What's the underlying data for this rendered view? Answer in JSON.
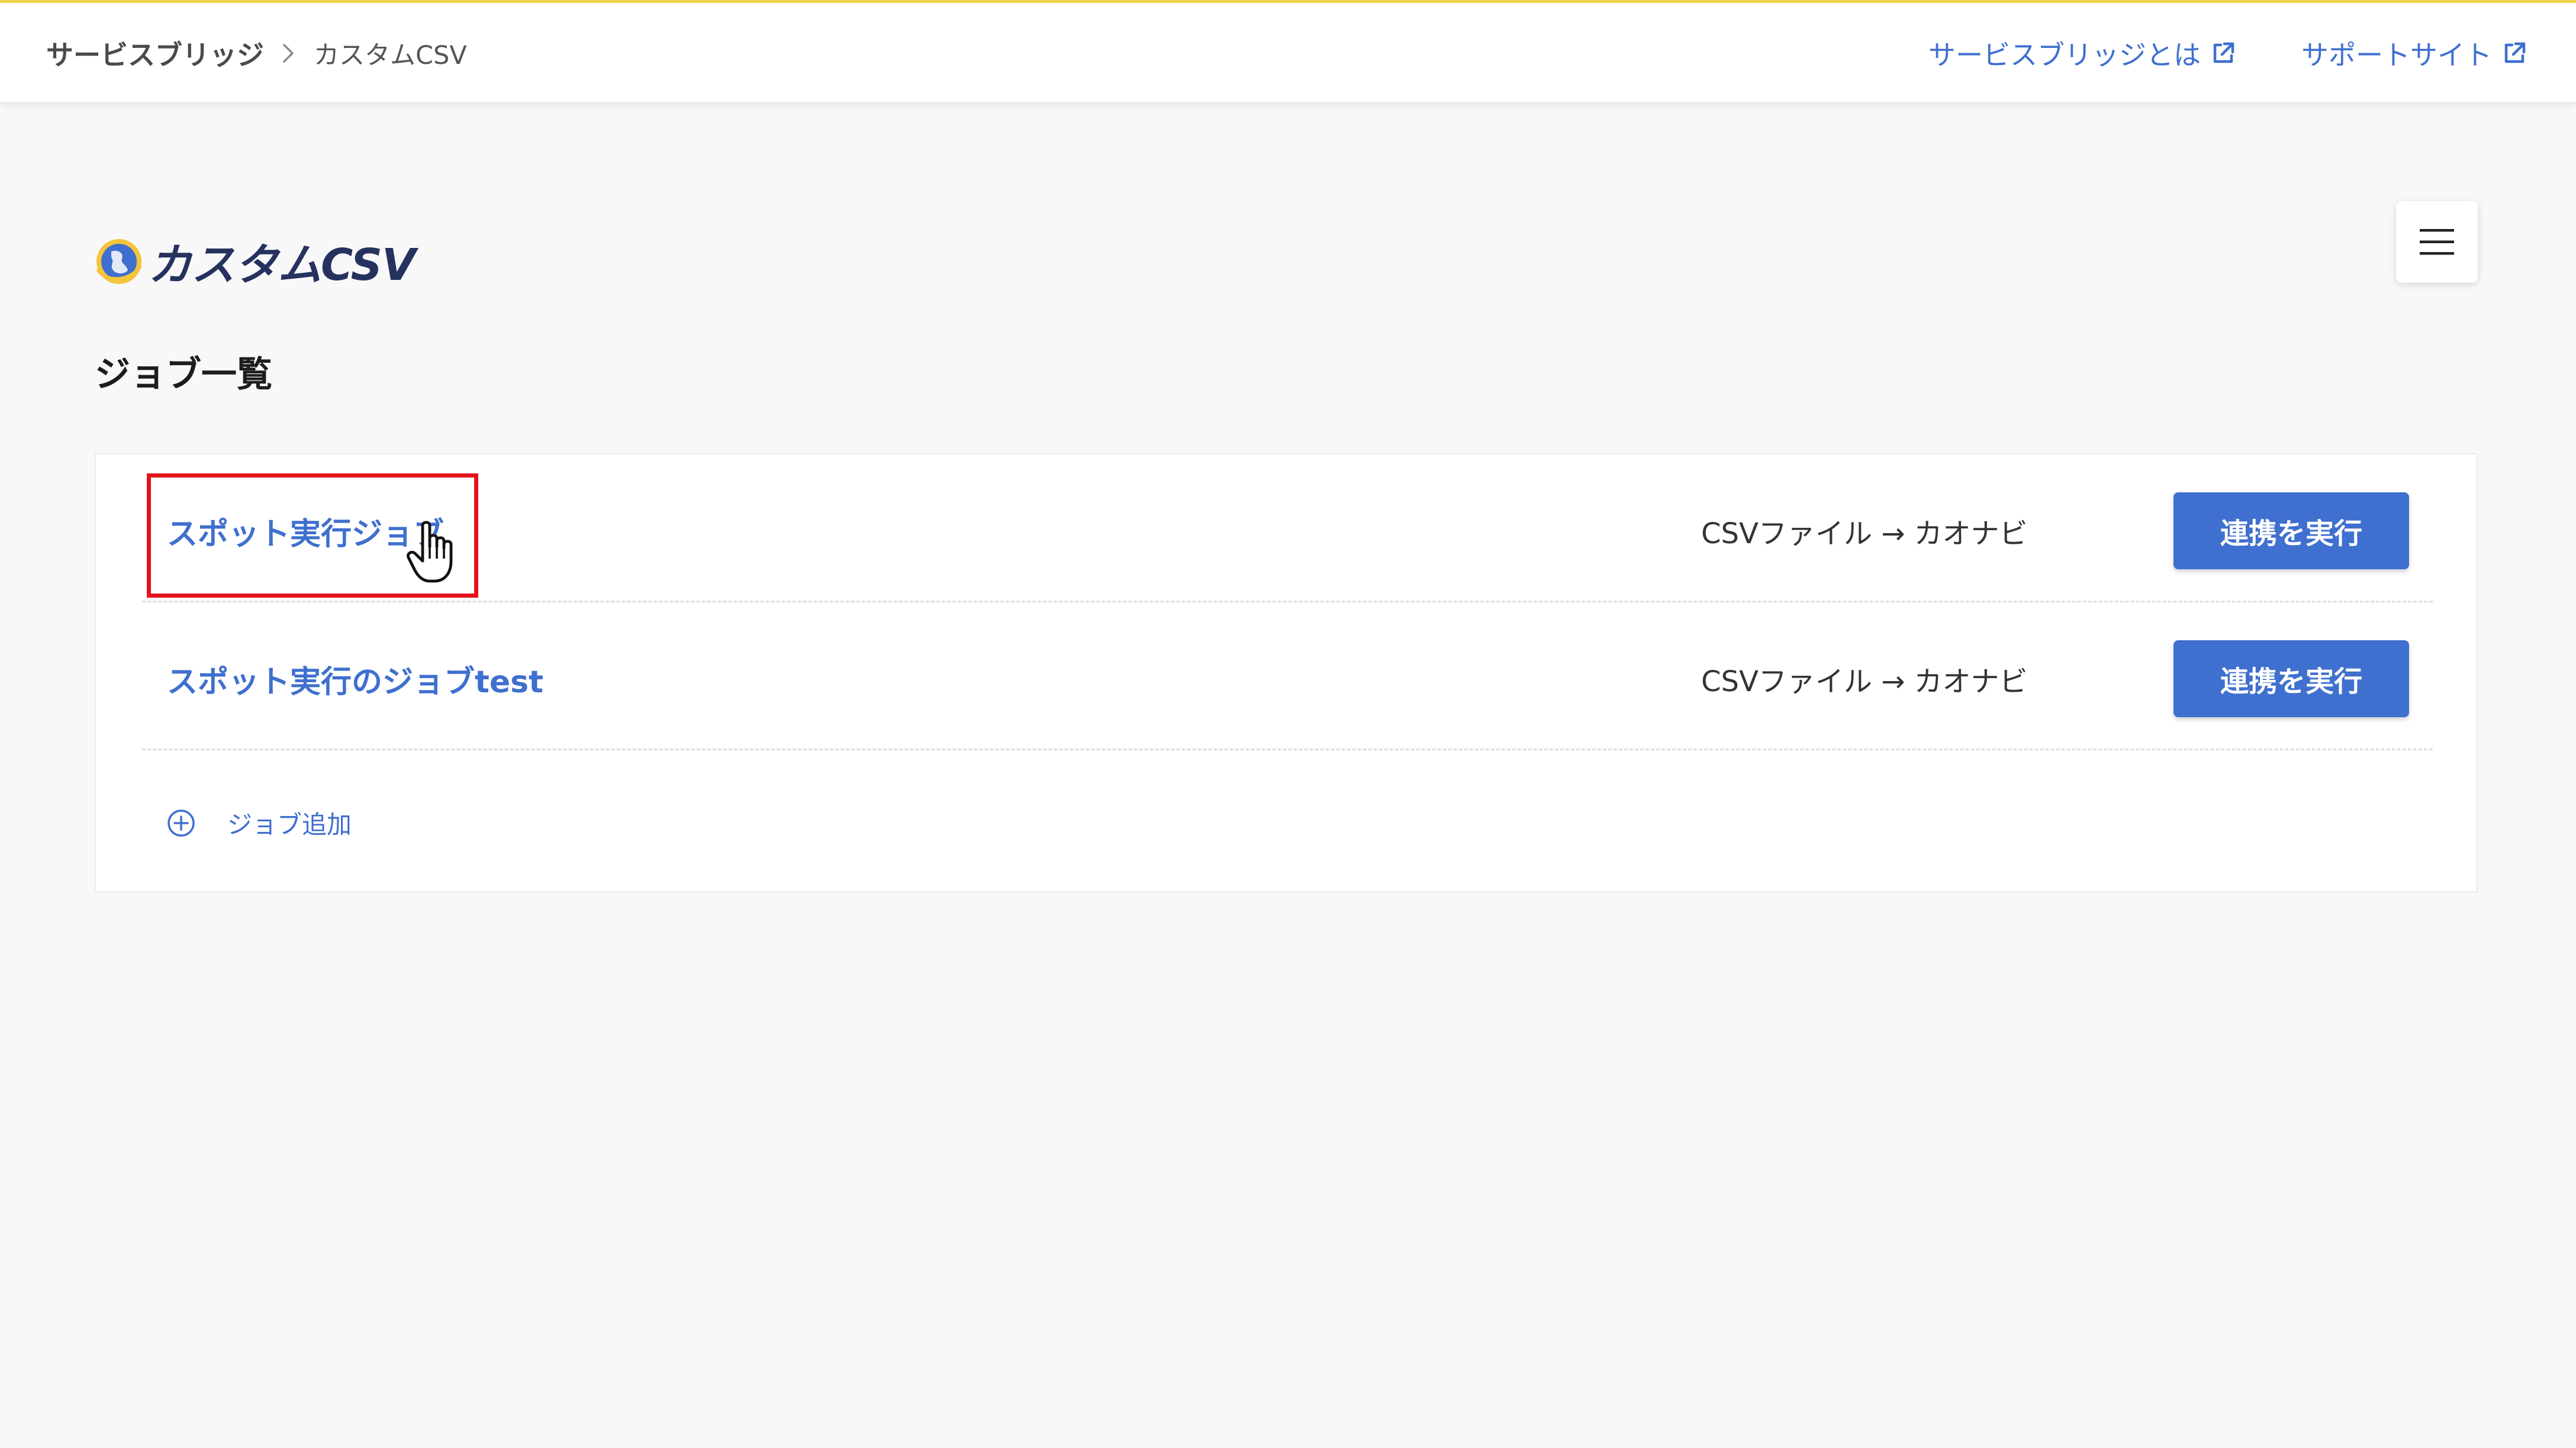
{
  "header": {
    "breadcrumb": {
      "root": "サービスブリッジ",
      "separator_icon": "chevron-right-icon",
      "current": "カスタムCSV"
    },
    "links": [
      {
        "label": "サービスブリッジとは",
        "icon": "external-link-icon"
      },
      {
        "label": "サポートサイト",
        "icon": "external-link-icon"
      }
    ],
    "accent_color": "#f1d34a"
  },
  "logo": {
    "text": "カスタムCSV",
    "icon": "globe-logo-icon"
  },
  "menu": {
    "icon": "hamburger-menu-icon"
  },
  "page": {
    "title": "ジョブ一覧"
  },
  "jobs": [
    {
      "name": "スポット実行ジョブ",
      "flow": "CSVファイル → カオナビ",
      "action_label": "連携を実行"
    },
    {
      "name": "スポット実行のジョブtest",
      "flow": "CSVファイル → カオナビ",
      "action_label": "連携を実行"
    }
  ],
  "add_job": {
    "label": "ジョブ追加",
    "icon": "plus-circle-icon"
  },
  "annotation": {
    "highlight_color": "#e3141b",
    "cursor_icon": "hand-pointer-icon"
  },
  "colors": {
    "link": "#3f6fcf",
    "button": "#3f6fcf",
    "background": "#f8f8f9"
  }
}
